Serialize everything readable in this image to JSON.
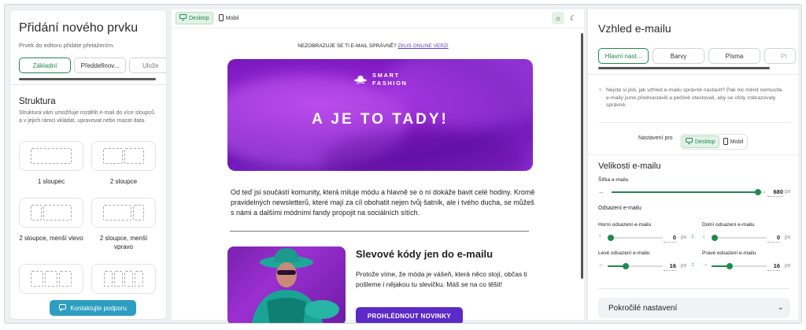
{
  "left": {
    "title": "Přidání nového prvku",
    "subtitle": "Prvek do editoru přidáte přetažením.",
    "tabs": [
      "Základní",
      "Předdefinov...",
      "Ulože"
    ],
    "section_title": "Struktura",
    "section_desc": "Struktura vám umožňuje rozdělit e-mail do více sloupců a v jejich rámci vkládat, upravovat nebo mazat data.",
    "layouts": [
      "1 sloupec",
      "2 sloupce",
      "2 sloupce, menší vlevo",
      "2 sloupce, menší vpravo"
    ],
    "support_button": "Kontaktujte podporu"
  },
  "center": {
    "view_modes": [
      "Desktop",
      "Mobil"
    ],
    "notice_text": "NEZOBRAZUJE SE TI E-MAIL SPRÁVNĚ?",
    "notice_link": "ZKUS ONLINE VERZI",
    "brand_line1": "SMART",
    "brand_line2": "FASHION",
    "hero_title": "A JE TO TADY!",
    "paragraph": "Od teď jsi součástí komunity, která miluje módu a hlavně se o ní dokáže bavit celé hodiny. Kromě pravidelných newsletterů, které mají za cíl obohatit nejen tvůj šatník, ale i tvého ducha, se můžeš s námi a dalšími módními fandy propojit na sociálních sítích.",
    "product_title": "Slevové kódy jen do e-mailu",
    "product_text": "Protože víme, že móda je vášeň, která něco stojí, občas ti pošleme i nějakou tu slevičku. Máš se na co těšit!",
    "product_button": "PROHLÉDNOUT NOVINKY"
  },
  "right": {
    "title": "Vzhled e-mailu",
    "tabs": [
      "Hlavní nast...",
      "Barvy",
      "Písma",
      "Pr"
    ],
    "tip": "Nejste si jisti, jak vzhled e-mailu správně nastavit? Pak nic měnit nemusíte. e-maily jsme přednastavili a pečlivě otestovali, aby se vždy zobrazovaly správně.",
    "settings_for": "Nastavení pro",
    "modes": [
      "Desktop",
      "Mobil"
    ],
    "size_heading": "Velikosti e-mailu",
    "width_label": "Šířka e-mailu",
    "width_value": "680",
    "width_fraction": 0.95,
    "unit": "px",
    "padding_heading": "Odsazení e-mailu",
    "top_label": "Horní odsazení e-mailu",
    "top_value": "0",
    "bottom_label": "Dolní odsazení e-mailu",
    "bottom_value": "0",
    "left_label": "Levé odsazení e-mailu",
    "left_value": "16",
    "right_label": "Pravé odsazení e-mailu",
    "right_value": "16",
    "advanced": "Pokročilé nastavení"
  }
}
